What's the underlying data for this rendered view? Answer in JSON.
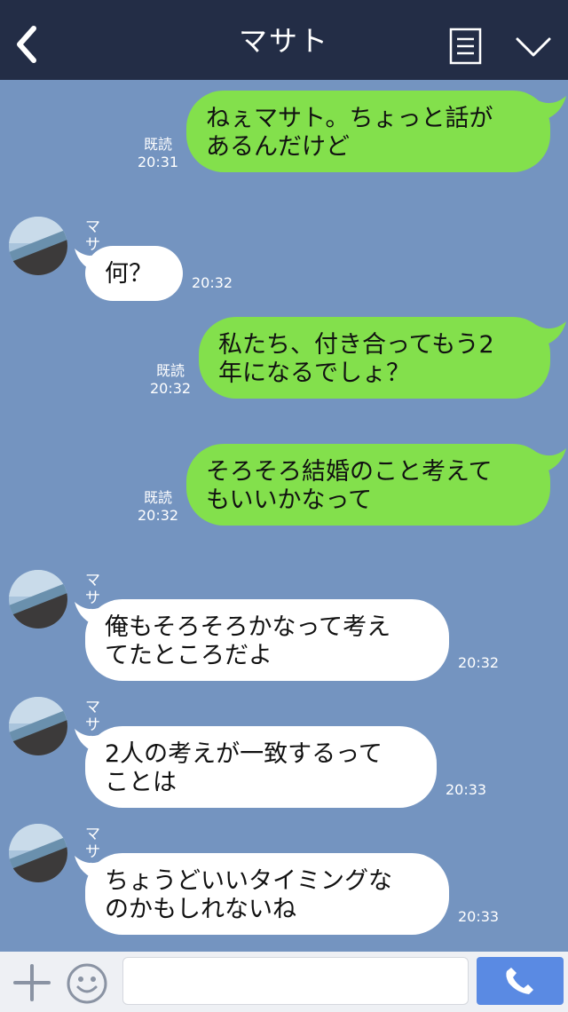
{
  "header": {
    "title": "マサト",
    "back_icon": "chevron-left-icon",
    "notes_icon": "notes-icon",
    "menu_icon": "chevron-down-icon"
  },
  "colors": {
    "header_bg": "#232d46",
    "chat_bg": "#7494c0",
    "sent_bubble": "#83e04c",
    "received_bubble": "#ffffff",
    "call_button": "#5a8ae3"
  },
  "messages": [
    {
      "side": "sent",
      "lines": [
        "ねぇマサト。ちょっと話が",
        "あるんだけど"
      ],
      "read": "既読",
      "time": "20:31"
    },
    {
      "side": "received",
      "sender": "マサト",
      "lines": [
        "何？"
      ],
      "time": "20:32"
    },
    {
      "side": "sent",
      "lines": [
        "私たち、付き合ってもう2",
        "年になるでしょ？"
      ],
      "read": "既読",
      "time": "20:32"
    },
    {
      "side": "sent",
      "lines": [
        "そろそろ結婚のこと考えて",
        "もいいかなって"
      ],
      "read": "既読",
      "time": "20:32"
    },
    {
      "side": "received",
      "sender": "マサト",
      "lines": [
        "俺もそろそろかなって考え",
        "てたところだよ"
      ],
      "time": "20:32"
    },
    {
      "side": "received",
      "sender": "マサト",
      "lines": [
        "2人の考えが一致するって",
        "ことは"
      ],
      "time": "20:33"
    },
    {
      "side": "received",
      "sender": "マサト",
      "lines": [
        "ちょうどいいタイミングな",
        "のかもしれないね"
      ],
      "time": "20:33"
    }
  ],
  "input_bar": {
    "plus_icon": "plus-icon",
    "sticker_icon": "smiley-icon",
    "message_value": "",
    "call_icon": "phone-icon"
  }
}
